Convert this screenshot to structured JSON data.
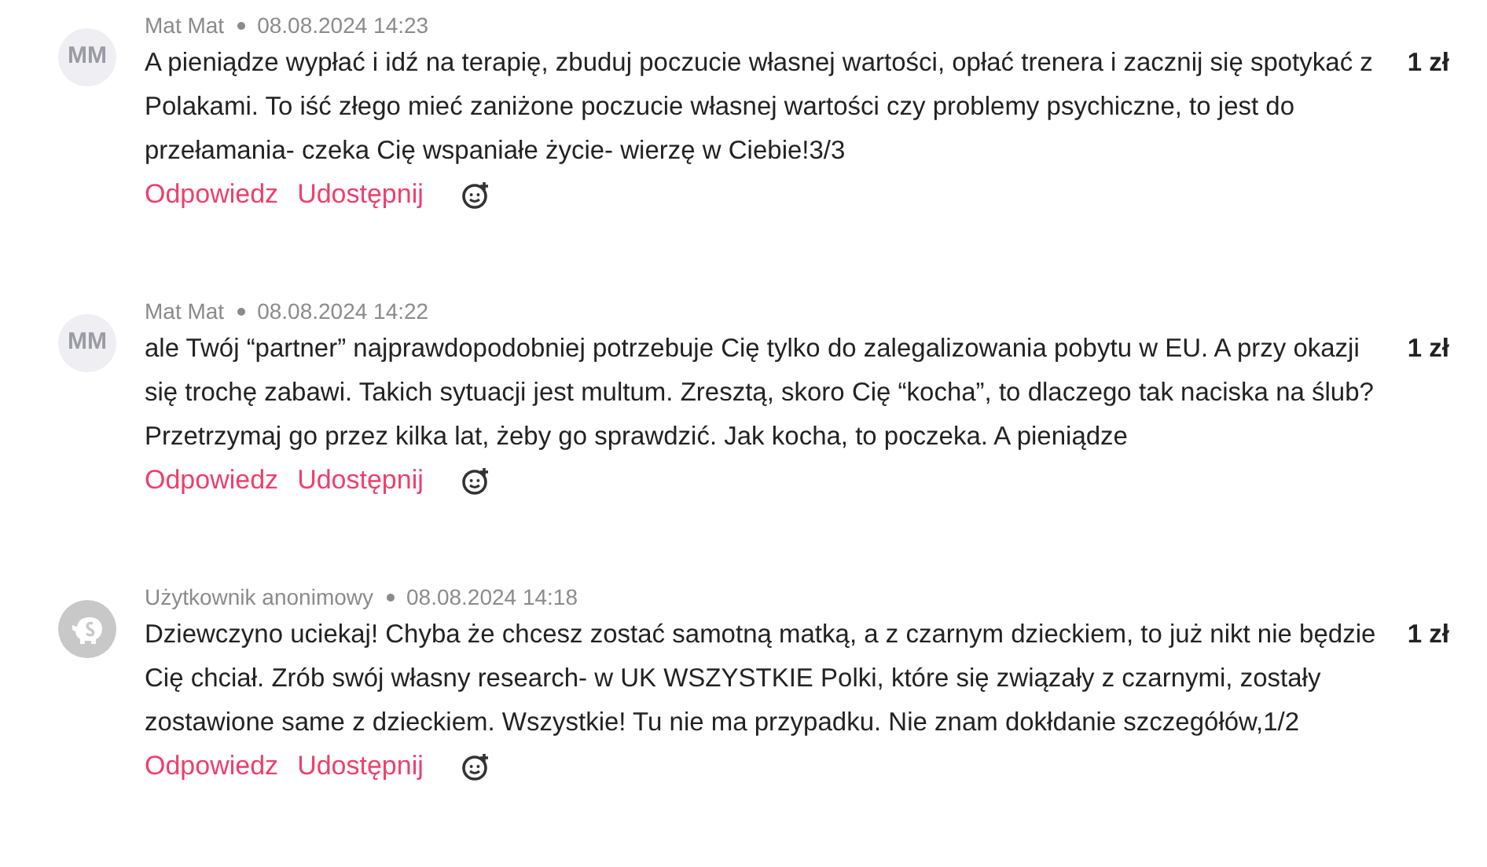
{
  "comments": [
    {
      "avatar": {
        "kind": "initials",
        "text": "MM"
      },
      "author": "Mat Mat",
      "date": "08.08.2024 14:23",
      "body": "A pieniądze wypłać i idź na terapię, zbuduj poczucie własnej wartości, opłać trenera i zacznij się spotykać z Polakami. To iść złego mieć zaniżone poczucie własnej wartości czy problemy psychiczne, to jest do przełamania- czeka Cię wspaniałe życie- wierzę w Ciebie!3/3",
      "amount": "1 zł",
      "actions": [
        "Odpowiedz",
        "Udostępnij"
      ]
    },
    {
      "avatar": {
        "kind": "initials",
        "text": "MM"
      },
      "author": "Mat Mat",
      "date": "08.08.2024 14:22",
      "body": "ale Twój “partner” najprawdopodobniej potrzebuje Cię tylko do zalegalizowania pobytu w EU. A przy okazji się trochę zabawi. Takich sytuacji jest multum. Zresztą, skoro Cię “kocha”, to dlaczego tak naciska na ślub? Przetrzymaj go przez kilka lat, żeby go sprawdzić. Jak kocha, to poczeka. A pieniądze",
      "amount": "1 zł",
      "actions": [
        "Odpowiedz",
        "Udostępnij"
      ]
    },
    {
      "avatar": {
        "kind": "anonymous"
      },
      "author": "Użytkownik anonimowy",
      "date": "08.08.2024 14:18",
      "body": "Dziewczyno uciekaj! Chyba że chcesz zostać samotną matką, a z czarnym dzieckiem, to już nikt nie będzie Cię chciał. Zrób swój własny research- w UK WSZYSTKIE Polki, które się związały z czarnymi, zostały zostawione same z dzieckiem. Wszystkie! Tu nie ma przypadku. Nie znam dokłdanie szczegółów,1/2",
      "amount": "1 zł",
      "actions": [
        "Odpowiedz",
        "Udostępnij"
      ]
    }
  ]
}
